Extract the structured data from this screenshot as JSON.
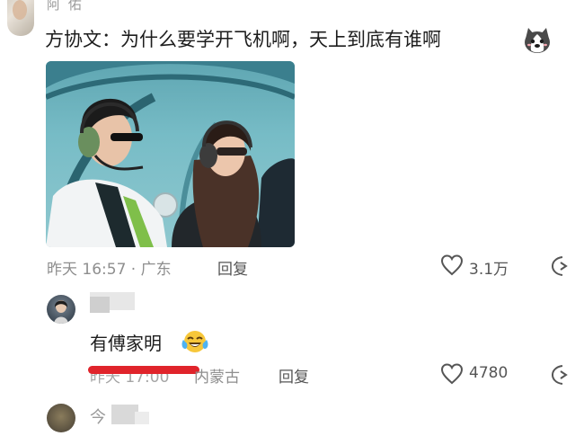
{
  "top": {
    "name_partial": "阿 佑"
  },
  "comment": {
    "text": "方协文：为什么要学开飞机啊，天上到底有谁啊",
    "emoji": "husky-emoji",
    "meta": "昨天 16:57 · 广东",
    "reply_label": "回复",
    "like_count": "3.1万"
  },
  "reply": {
    "text": "有傅家明",
    "emoji": "laughing-crying-emoji",
    "meta_time": "昨天 17:00",
    "meta_loc": "内蒙古",
    "reply_label": "回复",
    "like_count": "4780",
    "redaction_color": "#e0242b"
  },
  "next": {
    "name_partial": "今"
  }
}
